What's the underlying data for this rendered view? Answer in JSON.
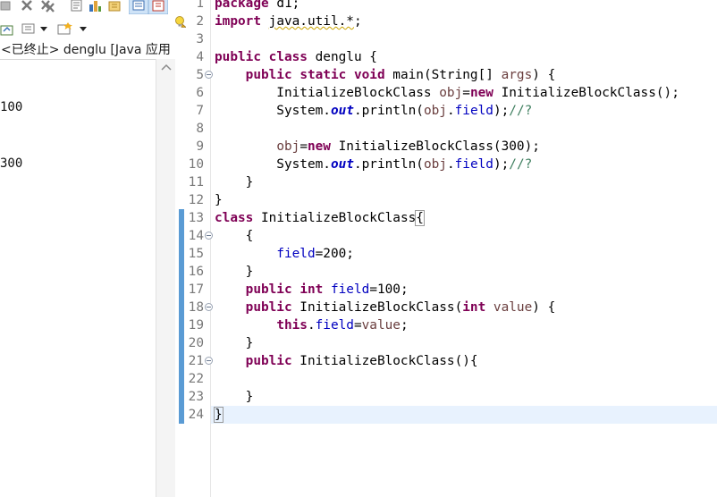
{
  "console": {
    "header": "<已终止> denglu [Java 应用",
    "output": [
      "100",
      "300"
    ],
    "toolbar_icons": [
      "terminate-icon",
      "remove-launch-icon",
      "remove-all-terminated-icon",
      "scroll-lock-icon",
      "show-stdout-icon",
      "show-stderr-icon",
      "pin-console-icon",
      "display-selected-console-icon",
      "open-console-icon"
    ]
  },
  "editor": {
    "file": "denglu.java",
    "current_line": 24,
    "lines": [
      {
        "n": "1",
        "tokens": [
          [
            "kw",
            "package"
          ],
          [
            "t",
            " d1;"
          ]
        ]
      },
      {
        "n": "2",
        "tokens": [
          [
            "kw",
            "import"
          ],
          [
            "t",
            " "
          ],
          [
            "w",
            "java.util.*"
          ],
          [
            "t",
            ";"
          ]
        ],
        "warning": true
      },
      {
        "n": "3",
        "tokens": []
      },
      {
        "n": "4",
        "tokens": [
          [
            "kw",
            "public"
          ],
          [
            "t",
            " "
          ],
          [
            "kw",
            "class"
          ],
          [
            "t",
            " denglu {"
          ]
        ]
      },
      {
        "n": "5",
        "fold": true,
        "tokens": [
          [
            "t",
            "    "
          ],
          [
            "kw",
            "public"
          ],
          [
            "t",
            " "
          ],
          [
            "kw",
            "static"
          ],
          [
            "t",
            " "
          ],
          [
            "kw",
            "void"
          ],
          [
            "t",
            " main(String[] "
          ],
          [
            "par",
            "args"
          ],
          [
            "t",
            ") {"
          ]
        ]
      },
      {
        "n": "6",
        "tokens": [
          [
            "t",
            "        InitializeBlockClass "
          ],
          [
            "par",
            "obj"
          ],
          [
            "t",
            "="
          ],
          [
            "kw",
            "new"
          ],
          [
            "t",
            " InitializeBlockClass();"
          ]
        ]
      },
      {
        "n": "7",
        "tokens": [
          [
            "t",
            "        System."
          ],
          [
            "sfld",
            "out"
          ],
          [
            "t",
            ".println("
          ],
          [
            "par",
            "obj"
          ],
          [
            "t",
            "."
          ],
          [
            "fld",
            "field"
          ],
          [
            "t",
            ");"
          ],
          [
            "cm",
            "//?"
          ]
        ]
      },
      {
        "n": "8",
        "tokens": []
      },
      {
        "n": "9",
        "tokens": [
          [
            "t",
            "        "
          ],
          [
            "par",
            "obj"
          ],
          [
            "t",
            "="
          ],
          [
            "kw",
            "new"
          ],
          [
            "t",
            " InitializeBlockClass(300);"
          ]
        ]
      },
      {
        "n": "10",
        "tokens": [
          [
            "t",
            "        System."
          ],
          [
            "sfld",
            "out"
          ],
          [
            "t",
            ".println("
          ],
          [
            "par",
            "obj"
          ],
          [
            "t",
            "."
          ],
          [
            "fld",
            "field"
          ],
          [
            "t",
            ");"
          ],
          [
            "cm",
            "//?"
          ]
        ]
      },
      {
        "n": "11",
        "tokens": [
          [
            "t",
            "    }"
          ]
        ]
      },
      {
        "n": "12",
        "tokens": [
          [
            "t",
            "}"
          ]
        ]
      },
      {
        "n": "13",
        "change": true,
        "tokens": [
          [
            "kw",
            "class"
          ],
          [
            "t",
            " InitializeBlockClass"
          ],
          [
            "box",
            "{"
          ]
        ]
      },
      {
        "n": "14",
        "change": true,
        "fold": true,
        "tokens": [
          [
            "t",
            "    {"
          ]
        ]
      },
      {
        "n": "15",
        "change": true,
        "tokens": [
          [
            "t",
            "        "
          ],
          [
            "fld",
            "field"
          ],
          [
            "t",
            "=200;"
          ]
        ]
      },
      {
        "n": "16",
        "change": true,
        "tokens": [
          [
            "t",
            "    }"
          ]
        ]
      },
      {
        "n": "17",
        "change": true,
        "tokens": [
          [
            "t",
            "    "
          ],
          [
            "kw",
            "public"
          ],
          [
            "t",
            " "
          ],
          [
            "kw",
            "int"
          ],
          [
            "t",
            " "
          ],
          [
            "fld",
            "field"
          ],
          [
            "t",
            "=100;"
          ]
        ]
      },
      {
        "n": "18",
        "change": true,
        "fold": true,
        "tokens": [
          [
            "t",
            "    "
          ],
          [
            "kw",
            "public"
          ],
          [
            "t",
            " InitializeBlockClass("
          ],
          [
            "kw",
            "int"
          ],
          [
            "t",
            " "
          ],
          [
            "par",
            "value"
          ],
          [
            "t",
            ") {"
          ]
        ]
      },
      {
        "n": "19",
        "change": true,
        "tokens": [
          [
            "t",
            "        "
          ],
          [
            "kw",
            "this"
          ],
          [
            "t",
            "."
          ],
          [
            "fld",
            "field"
          ],
          [
            "t",
            "="
          ],
          [
            "par",
            "value"
          ],
          [
            "t",
            ";"
          ]
        ]
      },
      {
        "n": "20",
        "change": true,
        "tokens": [
          [
            "t",
            "    }"
          ]
        ]
      },
      {
        "n": "21",
        "change": true,
        "fold": true,
        "tokens": [
          [
            "t",
            "    "
          ],
          [
            "kw",
            "public"
          ],
          [
            "t",
            " InitializeBlockClass(){"
          ]
        ]
      },
      {
        "n": "22",
        "change": true,
        "tokens": []
      },
      {
        "n": "23",
        "change": true,
        "tokens": [
          [
            "t",
            "    }"
          ]
        ]
      },
      {
        "n": "24",
        "change": true,
        "tokens": [
          [
            "box",
            "}"
          ],
          [
            "caret",
            ""
          ]
        ]
      }
    ]
  },
  "colors": {
    "keyword": "#7f0055",
    "field": "#0000c0",
    "param": "#6a3e3e",
    "comment": "#3f7f5f",
    "change_bar": "#5a9bd4",
    "current_line": "#e8f2fe"
  }
}
